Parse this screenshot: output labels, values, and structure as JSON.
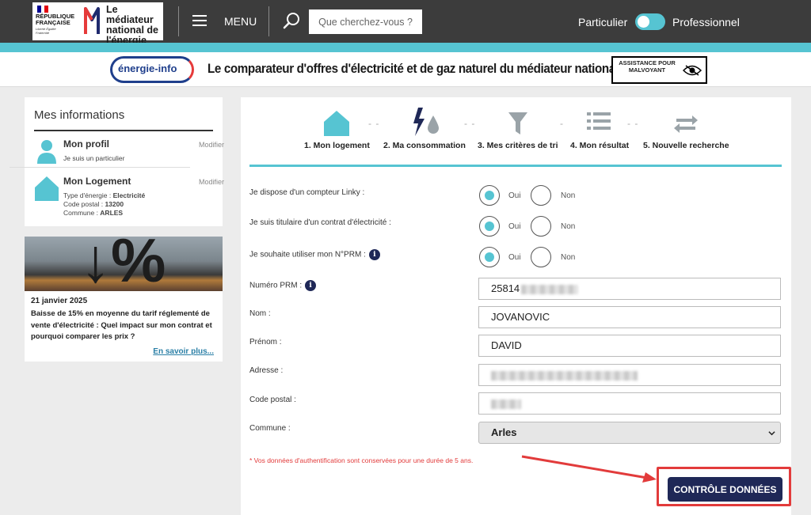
{
  "header": {
    "republic": "RÉPUBLIQUE FRANÇAISE",
    "devise": "Liberté Égalité Fraternité",
    "brand": "Le médiateur national de l'énergie",
    "menu_label": "MENU",
    "search_placeholder": "Que cherchez-vous ?",
    "profile_particulier": "Particulier",
    "profile_professionnel": "Professionnel"
  },
  "banner": {
    "logo_text": "énergie-info",
    "title": "Le comparateur d'offres d'électricité et de gaz naturel du médiateur national de l'énergie",
    "assist_label": "ASSISTANCE POUR MALVOYANT"
  },
  "sidebar": {
    "title": "Mes informations",
    "profil": {
      "title": "Mon profil",
      "modify": "Modifier",
      "desc": "Je suis un particulier"
    },
    "logement": {
      "title": "Mon Logement",
      "modify": "Modifier",
      "energy_label": "Type d'énergie : ",
      "energy_value": "Electricité",
      "postal_label": "Code postal : ",
      "postal_value": "13200",
      "commune_label": "Commune : ",
      "commune_value": "ARLES"
    },
    "news": {
      "image_glyph": "↓%",
      "date": "21 janvier 2025",
      "text": "Baisse de 15% en moyenne du tarif réglementé de vente d'électricité : Quel impact sur mon contrat et pourquoi comparer les prix ?",
      "more": "En savoir plus..."
    }
  },
  "steps": [
    {
      "label": "1. Mon logement"
    },
    {
      "label": "2. Ma consommation"
    },
    {
      "label": "3. Mes critères de tri"
    },
    {
      "label": "4. Mon résultat"
    },
    {
      "label": "5. Nouvelle recherche"
    }
  ],
  "form": {
    "linky": {
      "label": "Je dispose d'un compteur Linky :",
      "yes": "Oui",
      "no": "Non",
      "selected": "Oui"
    },
    "titulaire": {
      "label": "Je suis titulaire d'un contrat d'électricité :",
      "yes": "Oui",
      "no": "Non",
      "selected": "Oui"
    },
    "prm_use": {
      "label": "Je souhaite utiliser mon N°PRM :",
      "yes": "Oui",
      "no": "Non",
      "selected": "Oui"
    },
    "info_glyph": "i",
    "prm_number": {
      "label": "Numéro PRM :",
      "value": "25814"
    },
    "nom": {
      "label": "Nom :",
      "value": "JOVANOVIC"
    },
    "prenom": {
      "label": "Prénom :",
      "value": "DAVID"
    },
    "adresse": {
      "label": "Adresse :"
    },
    "code_postal": {
      "label": "Code postal :"
    },
    "commune": {
      "label": "Commune :",
      "value": "Arles"
    },
    "note": "* Vos données d'authentification sont conservées pour une durée de 5 ans.",
    "submit": "CONTRÔLE DONNÉES"
  },
  "colors": {
    "topbar": "#3c3c3c",
    "accent_cyan": "#56c4d2",
    "navy": "#1f2857",
    "highlight_red": "#e23b3b"
  }
}
